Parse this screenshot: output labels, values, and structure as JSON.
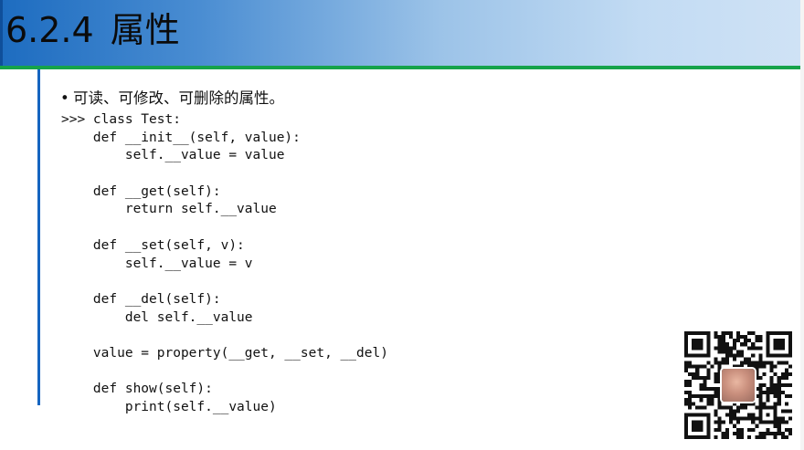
{
  "slide": {
    "section_number": "6.2.4",
    "title": "属性",
    "bullet_glyph": "•",
    "bullet_text": "可读、可修改、可删除的属性。",
    "code_lines": [
      ">>> class Test:",
      "    def __init__(self, value):",
      "        self.__value = value",
      "",
      "    def __get(self):",
      "        return self.__value",
      "",
      "    def __set(self, v):",
      "        self.__value = v",
      "",
      "    def __del(self):",
      "        del self.__value",
      "",
      "    value = property(__get, __set, __del)",
      "",
      "    def show(self):",
      "        print(self.__value)"
    ]
  },
  "colors": {
    "title_gradient_start": "#1d6cc0",
    "title_gradient_end": "#cfe2f5",
    "accent_green": "#16a34a",
    "accent_blue_line": "#1565c0"
  },
  "icons": {
    "qr": "qr-code-icon",
    "avatar": "avatar-icon"
  }
}
